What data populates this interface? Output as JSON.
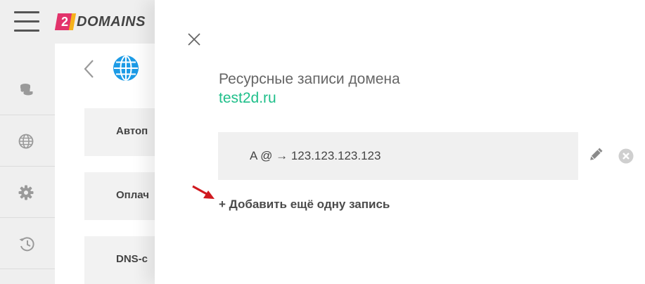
{
  "header": {
    "logo": {
      "badge": "2",
      "text": "DOMAINS"
    },
    "menu_icon": "hamburger-menu-icon"
  },
  "sidebar": {
    "items": [
      {
        "name": "coins",
        "icon": "coins-icon"
      },
      {
        "name": "domains",
        "icon": "globe-icon"
      },
      {
        "name": "settings",
        "icon": "gear-icon"
      },
      {
        "name": "history",
        "icon": "history-icon"
      }
    ]
  },
  "background": {
    "cards": [
      {
        "label": "Автоп"
      },
      {
        "label": "Оплач"
      },
      {
        "label": "DNS-с"
      }
    ]
  },
  "panel": {
    "title": "Ресурсные записи домена",
    "domain": "test2d.ru",
    "records": [
      {
        "text": "A @ → 123.123.123.123"
      }
    ],
    "add_label": "+ Добавить ещё одну запись"
  },
  "colors": {
    "accent_green": "#1fbf8a",
    "logo_pink": "#e2336b",
    "logo_yellow": "#f6b21c",
    "arrow_red": "#d0191f",
    "sidebar_bg": "#efefef",
    "record_bg": "#f0f0f0"
  }
}
